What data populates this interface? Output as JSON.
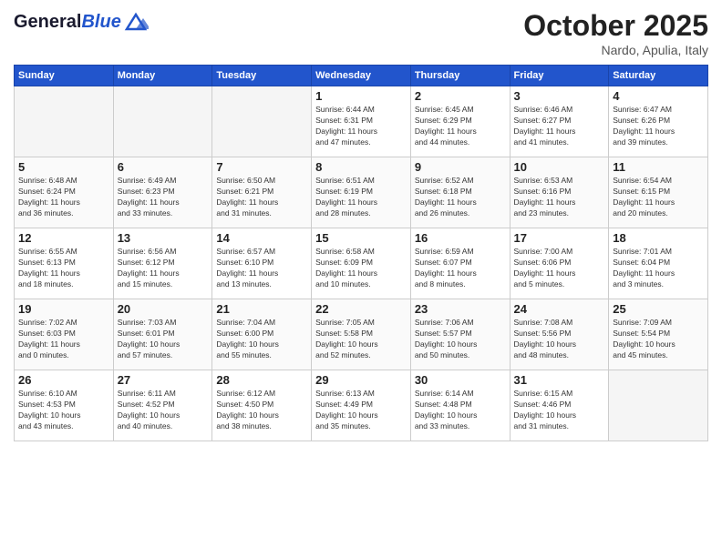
{
  "header": {
    "logo_general": "General",
    "logo_blue": "Blue",
    "month_title": "October 2025",
    "subtitle": "Nardo, Apulia, Italy"
  },
  "weekdays": [
    "Sunday",
    "Monday",
    "Tuesday",
    "Wednesday",
    "Thursday",
    "Friday",
    "Saturday"
  ],
  "weeks": [
    [
      {
        "day": "",
        "info": ""
      },
      {
        "day": "",
        "info": ""
      },
      {
        "day": "",
        "info": ""
      },
      {
        "day": "1",
        "info": "Sunrise: 6:44 AM\nSunset: 6:31 PM\nDaylight: 11 hours\nand 47 minutes."
      },
      {
        "day": "2",
        "info": "Sunrise: 6:45 AM\nSunset: 6:29 PM\nDaylight: 11 hours\nand 44 minutes."
      },
      {
        "day": "3",
        "info": "Sunrise: 6:46 AM\nSunset: 6:27 PM\nDaylight: 11 hours\nand 41 minutes."
      },
      {
        "day": "4",
        "info": "Sunrise: 6:47 AM\nSunset: 6:26 PM\nDaylight: 11 hours\nand 39 minutes."
      }
    ],
    [
      {
        "day": "5",
        "info": "Sunrise: 6:48 AM\nSunset: 6:24 PM\nDaylight: 11 hours\nand 36 minutes."
      },
      {
        "day": "6",
        "info": "Sunrise: 6:49 AM\nSunset: 6:23 PM\nDaylight: 11 hours\nand 33 minutes."
      },
      {
        "day": "7",
        "info": "Sunrise: 6:50 AM\nSunset: 6:21 PM\nDaylight: 11 hours\nand 31 minutes."
      },
      {
        "day": "8",
        "info": "Sunrise: 6:51 AM\nSunset: 6:19 PM\nDaylight: 11 hours\nand 28 minutes."
      },
      {
        "day": "9",
        "info": "Sunrise: 6:52 AM\nSunset: 6:18 PM\nDaylight: 11 hours\nand 26 minutes."
      },
      {
        "day": "10",
        "info": "Sunrise: 6:53 AM\nSunset: 6:16 PM\nDaylight: 11 hours\nand 23 minutes."
      },
      {
        "day": "11",
        "info": "Sunrise: 6:54 AM\nSunset: 6:15 PM\nDaylight: 11 hours\nand 20 minutes."
      }
    ],
    [
      {
        "day": "12",
        "info": "Sunrise: 6:55 AM\nSunset: 6:13 PM\nDaylight: 11 hours\nand 18 minutes."
      },
      {
        "day": "13",
        "info": "Sunrise: 6:56 AM\nSunset: 6:12 PM\nDaylight: 11 hours\nand 15 minutes."
      },
      {
        "day": "14",
        "info": "Sunrise: 6:57 AM\nSunset: 6:10 PM\nDaylight: 11 hours\nand 13 minutes."
      },
      {
        "day": "15",
        "info": "Sunrise: 6:58 AM\nSunset: 6:09 PM\nDaylight: 11 hours\nand 10 minutes."
      },
      {
        "day": "16",
        "info": "Sunrise: 6:59 AM\nSunset: 6:07 PM\nDaylight: 11 hours\nand 8 minutes."
      },
      {
        "day": "17",
        "info": "Sunrise: 7:00 AM\nSunset: 6:06 PM\nDaylight: 11 hours\nand 5 minutes."
      },
      {
        "day": "18",
        "info": "Sunrise: 7:01 AM\nSunset: 6:04 PM\nDaylight: 11 hours\nand 3 minutes."
      }
    ],
    [
      {
        "day": "19",
        "info": "Sunrise: 7:02 AM\nSunset: 6:03 PM\nDaylight: 11 hours\nand 0 minutes."
      },
      {
        "day": "20",
        "info": "Sunrise: 7:03 AM\nSunset: 6:01 PM\nDaylight: 10 hours\nand 57 minutes."
      },
      {
        "day": "21",
        "info": "Sunrise: 7:04 AM\nSunset: 6:00 PM\nDaylight: 10 hours\nand 55 minutes."
      },
      {
        "day": "22",
        "info": "Sunrise: 7:05 AM\nSunset: 5:58 PM\nDaylight: 10 hours\nand 52 minutes."
      },
      {
        "day": "23",
        "info": "Sunrise: 7:06 AM\nSunset: 5:57 PM\nDaylight: 10 hours\nand 50 minutes."
      },
      {
        "day": "24",
        "info": "Sunrise: 7:08 AM\nSunset: 5:56 PM\nDaylight: 10 hours\nand 48 minutes."
      },
      {
        "day": "25",
        "info": "Sunrise: 7:09 AM\nSunset: 5:54 PM\nDaylight: 10 hours\nand 45 minutes."
      }
    ],
    [
      {
        "day": "26",
        "info": "Sunrise: 6:10 AM\nSunset: 4:53 PM\nDaylight: 10 hours\nand 43 minutes."
      },
      {
        "day": "27",
        "info": "Sunrise: 6:11 AM\nSunset: 4:52 PM\nDaylight: 10 hours\nand 40 minutes."
      },
      {
        "day": "28",
        "info": "Sunrise: 6:12 AM\nSunset: 4:50 PM\nDaylight: 10 hours\nand 38 minutes."
      },
      {
        "day": "29",
        "info": "Sunrise: 6:13 AM\nSunset: 4:49 PM\nDaylight: 10 hours\nand 35 minutes."
      },
      {
        "day": "30",
        "info": "Sunrise: 6:14 AM\nSunset: 4:48 PM\nDaylight: 10 hours\nand 33 minutes."
      },
      {
        "day": "31",
        "info": "Sunrise: 6:15 AM\nSunset: 4:46 PM\nDaylight: 10 hours\nand 31 minutes."
      },
      {
        "day": "",
        "info": ""
      }
    ]
  ]
}
